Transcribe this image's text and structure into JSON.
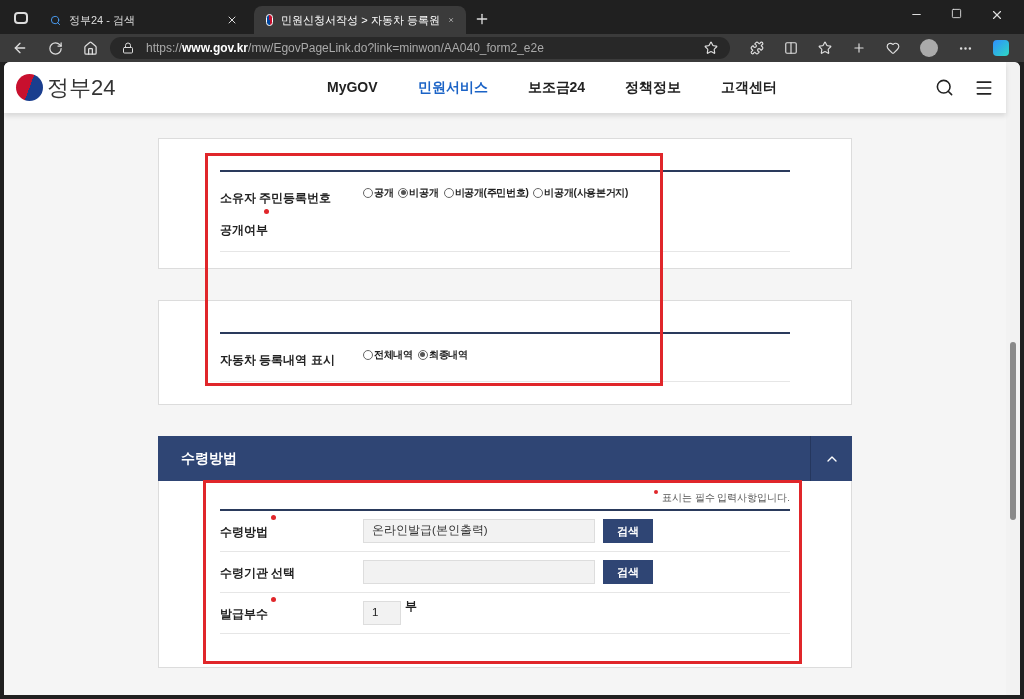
{
  "browser": {
    "tabs": [
      {
        "title": "정부24 - 검색",
        "selected": false
      },
      {
        "title": "민원신청서작성 > 자동차 등록원",
        "selected": true
      }
    ],
    "url_scheme": "https://",
    "url_host": "www.gov.kr",
    "url_path": "/mw/EgovPageLink.do?link=minwon/AA040_form2_e2e"
  },
  "site": {
    "logo": "정부24",
    "nav": [
      {
        "label": "MyGOV",
        "selected": false
      },
      {
        "label": "민원서비스",
        "selected": true
      },
      {
        "label": "보조금24",
        "selected": false
      },
      {
        "label": "정책정보",
        "selected": false
      },
      {
        "label": "고객센터",
        "selected": false
      }
    ]
  },
  "option_cards": [
    {
      "label_lines": [
        "소유자 주민등록번호",
        "공개여부"
      ],
      "required": true,
      "options": [
        {
          "label": "공개",
          "selected": false
        },
        {
          "label": "비공개",
          "selected": true
        },
        {
          "label": "비공개(주민번호)",
          "selected": false
        },
        {
          "label": "비공개(사용본거지)",
          "selected": false
        }
      ]
    },
    {
      "label_lines": [
        "자동차 등록내역 표시"
      ],
      "required": false,
      "options": [
        {
          "label": "전체내역",
          "selected": false
        },
        {
          "label": "최종내역",
          "selected": true
        }
      ]
    }
  ],
  "receipt": {
    "title": "수령방법",
    "expanded": true,
    "note": "표시는 필수 입력사항입니다.",
    "fields": [
      {
        "kind": "lookup",
        "label": "수령방법",
        "required": true,
        "value": "온라인발급(본인출력)",
        "button": "검색"
      },
      {
        "kind": "lookup",
        "label": "수령기관 선택",
        "required": false,
        "button": "검색"
      },
      {
        "kind": "count",
        "label": "발급부수",
        "required": true,
        "value": "1",
        "unit": "부"
      }
    ]
  }
}
